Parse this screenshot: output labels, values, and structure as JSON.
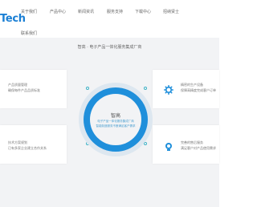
{
  "header": {
    "logo": "Tech",
    "nav": [
      "关于我们",
      "产品中心",
      "新闻资讯",
      "服务支持",
      "下载中心",
      "招纳贤士",
      "联系我们"
    ]
  },
  "section": {
    "title": "智高 · 电子产品一体化服务集成厂商",
    "center_title": "智高",
    "center_lines": [
      "电子产品一体化服务集成厂商",
      "智能制造服务不断满足客户需求"
    ]
  },
  "cards": {
    "left_top": [
      "产品质量管理",
      "确保每件产品品质标准"
    ],
    "left_bottom": [
      "技术方案规划",
      "已有多家企业建立合作关系"
    ],
    "right_top": [
      "精密的生产设备",
      "保障高精度完成客户订单"
    ],
    "right_bottom": [
      "完善的售后服务",
      "满足客户对产品使用需求"
    ]
  },
  "icons": {
    "right_top": "gear-icon",
    "right_bottom": "support-icon"
  },
  "colors": {
    "accent": "#1f8fdb",
    "logo": "#1a7fd4",
    "section_bg": "#f2f3f5"
  }
}
